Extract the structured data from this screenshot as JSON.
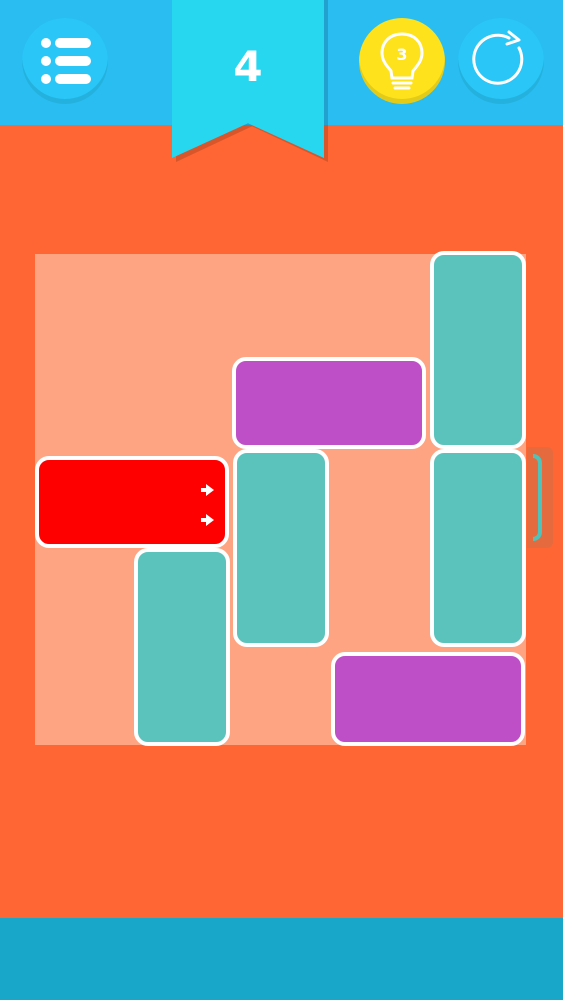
{
  "header": {
    "level": "4",
    "hints_remaining": "3"
  },
  "colors": {
    "background": "#ff6633",
    "topbar": "#29bdf2",
    "board": "#ffa482",
    "target_block": "#ff0000",
    "vertical_block": "#5cc2bc",
    "horizontal_block": "#bf4fc7",
    "hint_button": "#fde21c",
    "bottombar": "#18a6c9"
  },
  "icons": {
    "menu": "list-menu-icon",
    "hint": "lightbulb-icon",
    "restart": "restart-icon",
    "exit": "exit-bracket-icon"
  }
}
